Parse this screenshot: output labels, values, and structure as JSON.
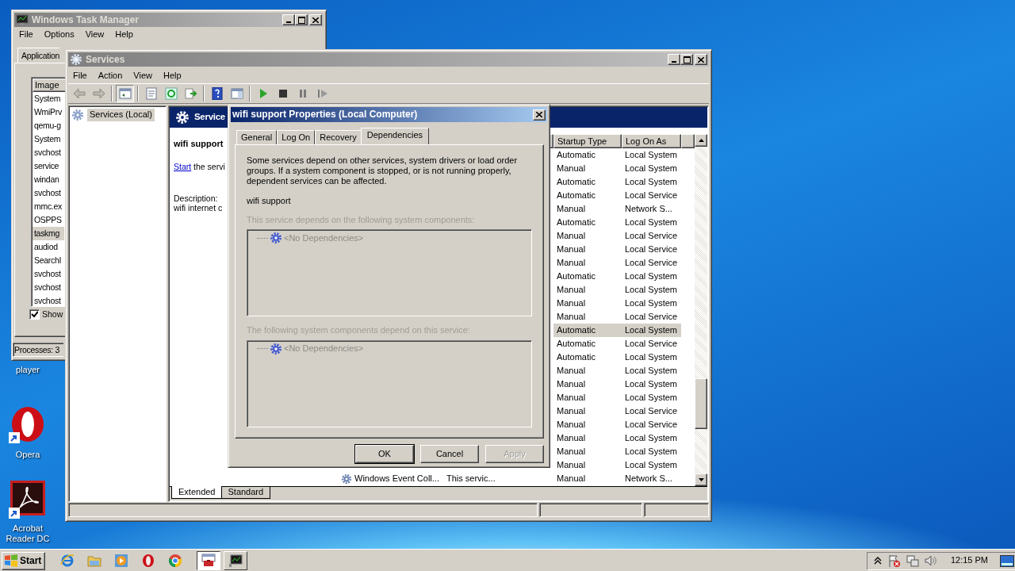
{
  "desktop_icons": [
    {
      "kind": "media",
      "label": "player"
    },
    {
      "kind": "browser",
      "label": "Opera"
    },
    {
      "kind": "reader",
      "label": "Acrobat Reader DC"
    }
  ],
  "task_manager": {
    "title": "Windows Task Manager",
    "menu": [
      "File",
      "Options",
      "View",
      "Help"
    ],
    "tabs": [
      {
        "label": "Application",
        "selected": true
      }
    ],
    "columns": [
      "Image"
    ],
    "rows": [
      {
        "name": "System",
        "selected": false
      },
      {
        "name": "WmiPrv",
        "selected": false
      },
      {
        "name": "qemu-g",
        "selected": false
      },
      {
        "name": "System",
        "selected": false
      },
      {
        "name": "svchost",
        "selected": false
      },
      {
        "name": "service",
        "selected": false
      },
      {
        "name": "windan",
        "selected": false
      },
      {
        "name": "svchost",
        "selected": false
      },
      {
        "name": "mmc.ex",
        "selected": false
      },
      {
        "name": "OSPPS",
        "selected": false
      },
      {
        "name": "taskmg",
        "selected": true
      },
      {
        "name": "audiod",
        "selected": false
      },
      {
        "name": "SearchI",
        "selected": false
      },
      {
        "name": "svchost",
        "selected": false
      },
      {
        "name": "svchost",
        "selected": false
      },
      {
        "name": "svchost",
        "selected": false
      }
    ],
    "show_all": {
      "label": "Show",
      "checked": true
    },
    "status": "Processes: 3"
  },
  "services": {
    "title": "Services",
    "menu": [
      "File",
      "Action",
      "View",
      "Help"
    ],
    "tree": [
      {
        "label": "Services (Local)",
        "selected": true
      }
    ],
    "header": "Service",
    "detail": {
      "name": "wifi support",
      "action_link": "Start",
      "action_text": " the servi",
      "description_label": "Description:",
      "description": "wifi internet c"
    },
    "columns": [
      "Startup Type",
      "Log On As"
    ],
    "rows": [
      {
        "startup": "Automatic",
        "logon": "Local System",
        "selected": false
      },
      {
        "startup": "Manual",
        "logon": "Local System",
        "selected": false
      },
      {
        "startup": "Automatic",
        "logon": "Local System",
        "selected": false
      },
      {
        "startup": "Automatic",
        "logon": "Local Service",
        "selected": false
      },
      {
        "startup": "Manual",
        "logon": "Network S...",
        "selected": false
      },
      {
        "startup": "Automatic",
        "logon": "Local System",
        "selected": false
      },
      {
        "startup": "Manual",
        "logon": "Local Service",
        "selected": false
      },
      {
        "startup": "Manual",
        "logon": "Local Service",
        "selected": false
      },
      {
        "startup": "Manual",
        "logon": "Local Service",
        "selected": false
      },
      {
        "startup": "Automatic",
        "logon": "Local System",
        "selected": false
      },
      {
        "startup": "Manual",
        "logon": "Local System",
        "selected": false
      },
      {
        "startup": "Manual",
        "logon": "Local System",
        "selected": false
      },
      {
        "startup": "Manual",
        "logon": "Local Service",
        "selected": false
      },
      {
        "startup": "Automatic",
        "logon": "Local System",
        "selected": true
      },
      {
        "startup": "Automatic",
        "logon": "Local Service",
        "selected": false
      },
      {
        "startup": "Automatic",
        "logon": "Local System",
        "selected": false
      },
      {
        "startup": "Manual",
        "logon": "Local System",
        "selected": false
      },
      {
        "startup": "Manual",
        "logon": "Local System",
        "selected": false
      },
      {
        "startup": "Manual",
        "logon": "Local System",
        "selected": false
      },
      {
        "startup": "Manual",
        "logon": "Local Service",
        "selected": false
      },
      {
        "startup": "Manual",
        "logon": "Local Service",
        "selected": false
      },
      {
        "startup": "Manual",
        "logon": "Local System",
        "selected": false
      },
      {
        "startup": "Manual",
        "logon": "Local System",
        "selected": false
      },
      {
        "startup": "Manual",
        "logon": "Local System",
        "selected": false
      },
      {
        "name": "Windows Event Coll...",
        "description": "This servic...",
        "startup": "Manual",
        "logon": "Network S...",
        "selected": false
      }
    ],
    "view_tabs": [
      {
        "label": "Extended",
        "selected": true
      },
      {
        "label": "Standard",
        "selected": false
      }
    ]
  },
  "dialog": {
    "title": "wifi support Properties (Local Computer)",
    "tabs": [
      {
        "label": "General",
        "selected": false
      },
      {
        "label": "Log On",
        "selected": false
      },
      {
        "label": "Recovery",
        "selected": false
      },
      {
        "label": "Dependencies",
        "selected": true
      }
    ],
    "intro": "Some services depend on other services, system drivers or load order groups. If a system component is stopped, or is not running properly, dependent services can be affected.",
    "service_name": "wifi support",
    "lists": [
      {
        "label": "This service depends on the following system components:",
        "disabled": true,
        "items": [
          "<No Dependencies>"
        ]
      },
      {
        "label": "The following system components depend on this service:",
        "disabled": true,
        "items": [
          "<No Dependencies>"
        ]
      }
    ],
    "buttons": [
      {
        "label": "OK",
        "default": true,
        "disabled": false
      },
      {
        "label": "Cancel",
        "default": false,
        "disabled": false
      },
      {
        "label": "Apply",
        "default": false,
        "disabled": true
      }
    ]
  },
  "taskbar": {
    "start": "Start",
    "quick_launch": [
      {
        "kind": "ie"
      },
      {
        "kind": "folder"
      },
      {
        "kind": "player"
      },
      {
        "kind": "opera"
      },
      {
        "kind": "chrome"
      }
    ],
    "tasks": [
      {
        "kind": "services",
        "selected": true
      },
      {
        "kind": "monitor",
        "selected": false
      }
    ],
    "clock": "12:15 PM"
  }
}
